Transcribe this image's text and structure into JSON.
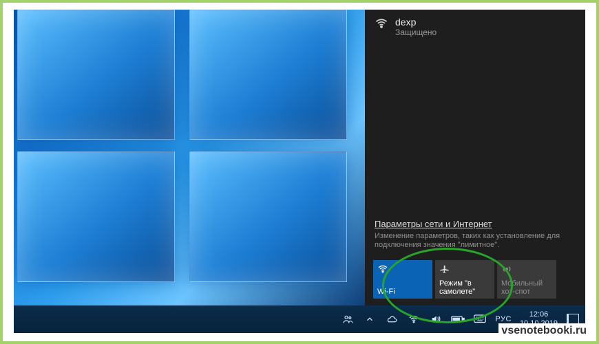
{
  "network": {
    "name": "dexp",
    "status": "Защищено"
  },
  "settings": {
    "link": "Параметры сети и Интернет",
    "description": "Изменение параметров, таких как установление для подключения значения \"лимитное\"."
  },
  "tiles": {
    "wifi": {
      "label": "Wi-Fi"
    },
    "airplane": {
      "label": "Режим \"в самолете\""
    },
    "hotspot": {
      "label": "Мобильный хот-спот"
    }
  },
  "taskbar": {
    "language": "РУС",
    "time": "12:06",
    "date": "10.10.2019"
  },
  "watermark": "vsenotebooki.ru"
}
